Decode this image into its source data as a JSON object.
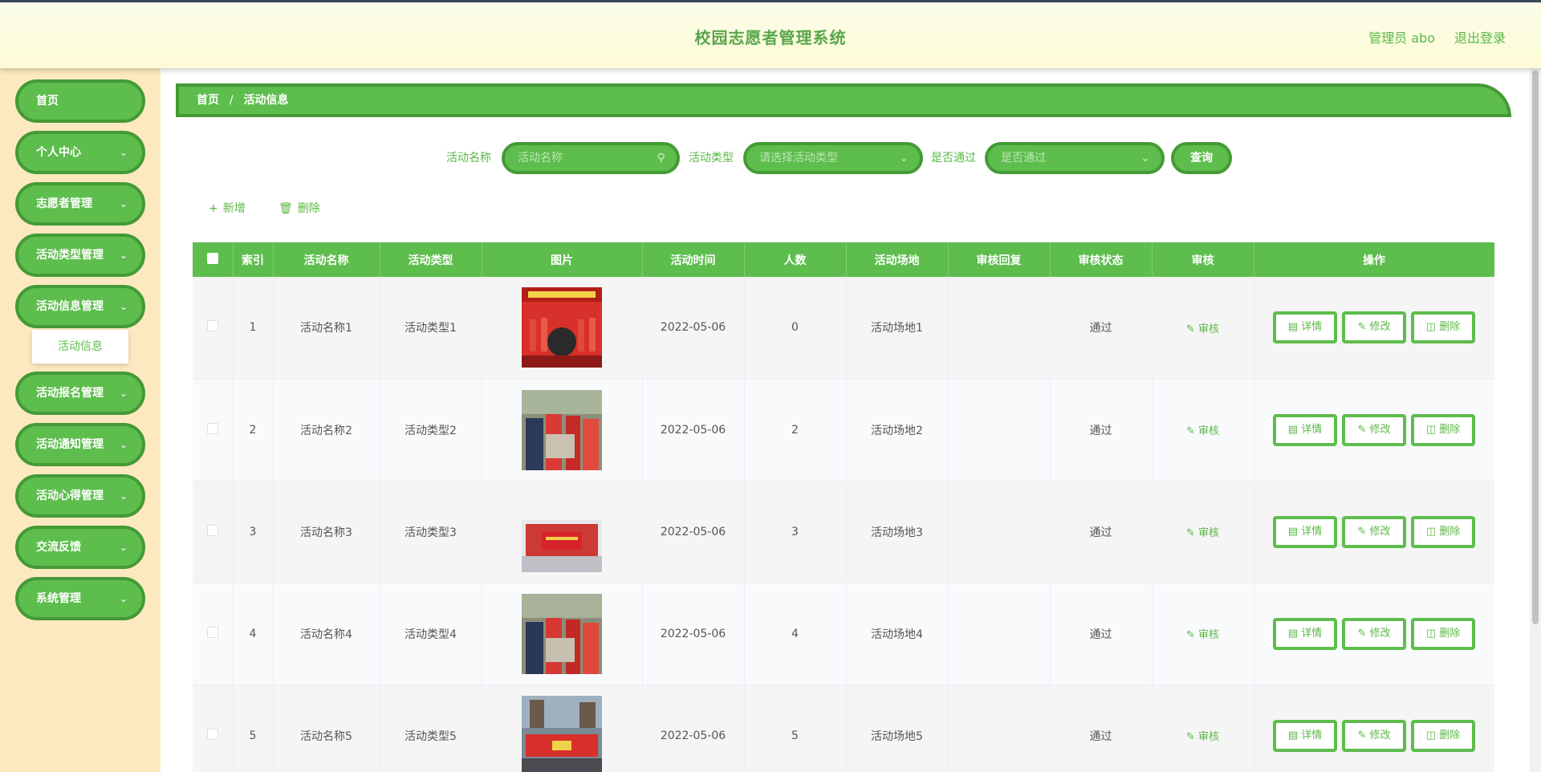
{
  "header": {
    "title": "校园志愿者管理系统",
    "user": "管理员 abo",
    "logout": "退出登录"
  },
  "sidebar": {
    "items": [
      {
        "label": "首页",
        "chevron": false
      },
      {
        "label": "个人中心",
        "chevron": true
      },
      {
        "label": "志愿者管理",
        "chevron": true
      },
      {
        "label": "活动类型管理",
        "chevron": true
      },
      {
        "label": "活动信息管理",
        "chevron": true
      },
      {
        "label": "活动报名管理",
        "chevron": true
      },
      {
        "label": "活动通知管理",
        "chevron": true
      },
      {
        "label": "活动心得管理",
        "chevron": true
      },
      {
        "label": "交流反馈",
        "chevron": true
      },
      {
        "label": "系统管理",
        "chevron": true
      }
    ],
    "submenu": {
      "label": "活动信息"
    }
  },
  "breadcrumb": {
    "home": "首页",
    "separator": "/",
    "current": "活动信息"
  },
  "search": {
    "name_label": "活动名称",
    "name_placeholder": "活动名称",
    "type_label": "活动类型",
    "type_placeholder": "请选择活动类型",
    "pass_label": "是否通过",
    "pass_placeholder": "是否通过",
    "query_button": "查询"
  },
  "toolbar": {
    "add_label": "新增",
    "delete_label": "删除"
  },
  "table": {
    "headers": [
      "索引",
      "活动名称",
      "活动类型",
      "图片",
      "活动时间",
      "人数",
      "活动场地",
      "审核回复",
      "审核状态",
      "审核",
      "操作"
    ],
    "audit_action": "审核",
    "detail_button": "详情",
    "edit_button": "修改",
    "delete_button": "删除",
    "rows": [
      {
        "index": "1",
        "name": "活动名称1",
        "type": "活动类型1",
        "time": "2022-05-06",
        "count": "0",
        "venue": "活动场地1",
        "reply": "",
        "status": "通过"
      },
      {
        "index": "2",
        "name": "活动名称2",
        "type": "活动类型2",
        "time": "2022-05-06",
        "count": "2",
        "venue": "活动场地2",
        "reply": "",
        "status": "通过"
      },
      {
        "index": "3",
        "name": "活动名称3",
        "type": "活动类型3",
        "time": "2022-05-06",
        "count": "3",
        "venue": "活动场地3",
        "reply": "",
        "status": "通过"
      },
      {
        "index": "4",
        "name": "活动名称4",
        "type": "活动类型4",
        "time": "2022-05-06",
        "count": "4",
        "venue": "活动场地4",
        "reply": "",
        "status": "通过"
      },
      {
        "index": "5",
        "name": "活动名称5",
        "type": "活动类型5",
        "time": "2022-05-06",
        "count": "5",
        "venue": "活动场地5",
        "reply": "",
        "status": "通过"
      }
    ]
  },
  "colors": {
    "primary": "#5dbd4d",
    "primary_border": "#449a36",
    "sidebar_bg": "#fde9bf",
    "header_bg": "#fdfbd6"
  }
}
